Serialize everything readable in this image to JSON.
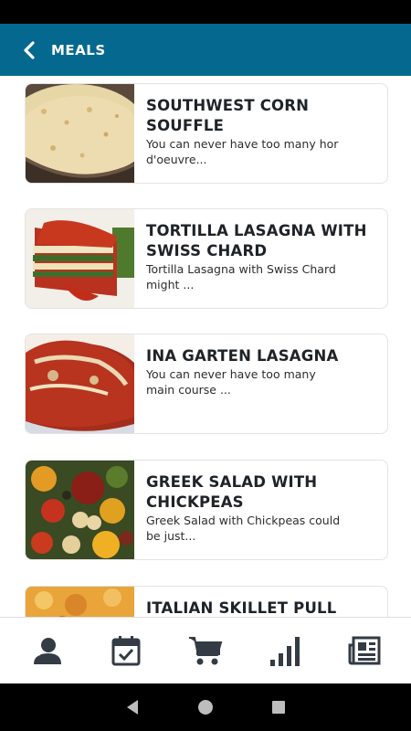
{
  "header": {
    "title": "MEALS"
  },
  "meals": [
    {
      "title": "SOUTHWEST CORN SOUFFLE",
      "description": "You can never have too many hor d'oeuvre..."
    },
    {
      "title": "TORTILLA LASAGNA WITH SWISS CHARD",
      "description": "Tortilla Lasagna with Swiss Chard might ..."
    },
    {
      "title": "INA GARTEN LASAGNA",
      "description": "You can never have too many main course ..."
    },
    {
      "title": "GREEK SALAD WITH CHICKPEAS",
      "description": "Greek Salad with Chickpeas could be just..."
    },
    {
      "title": "ITALIAN SKILLET PULL",
      "description": ""
    }
  ],
  "bottom_nav": {
    "items": [
      {
        "icon": "profile-icon"
      },
      {
        "icon": "calendar-check-icon"
      },
      {
        "icon": "cart-icon"
      },
      {
        "icon": "bar-chart-icon"
      },
      {
        "icon": "newspaper-icon"
      }
    ]
  },
  "colors": {
    "header": "#05698f",
    "icon": "#333b44"
  }
}
